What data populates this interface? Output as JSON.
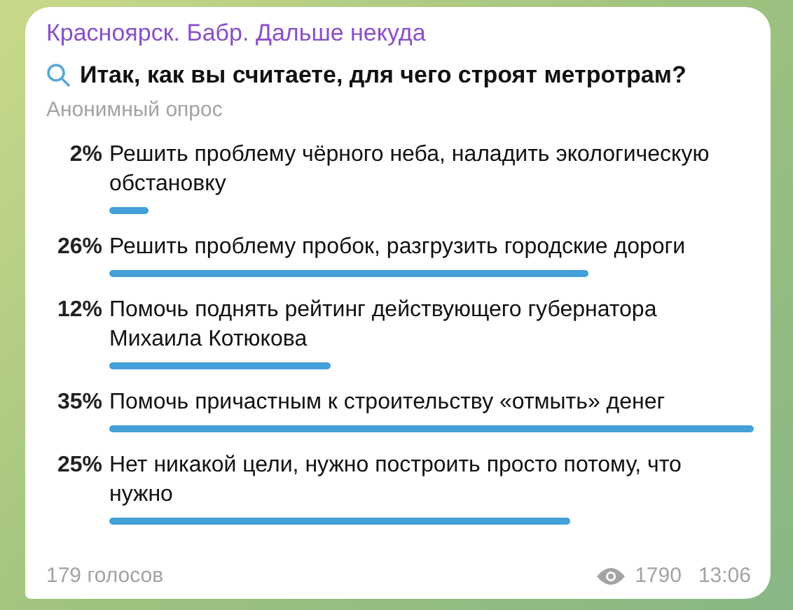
{
  "channel": "Красноярск. Бабр. Дальше некуда",
  "question": "Итак, как вы считаете, для чего строят метротрам?",
  "poll_type": "Анонимный опрос",
  "options": [
    {
      "percent": "2%",
      "text": "Решить проблему чёрного неба, наладить экологическую обстановку"
    },
    {
      "percent": "26%",
      "text": "Решить проблему пробок, разгрузить городские дороги"
    },
    {
      "percent": "12%",
      "text": "Помочь поднять рейтинг действующего губернатора Михаила Котюкова"
    },
    {
      "percent": "35%",
      "text": "Помочь причастным к строительству «отмыть» денег"
    },
    {
      "percent": "25%",
      "text": "Нет никакой цели, нужно построить просто потому, что нужно"
    }
  ],
  "votes": "179 голосов",
  "views": "1790",
  "time": "13:06"
}
